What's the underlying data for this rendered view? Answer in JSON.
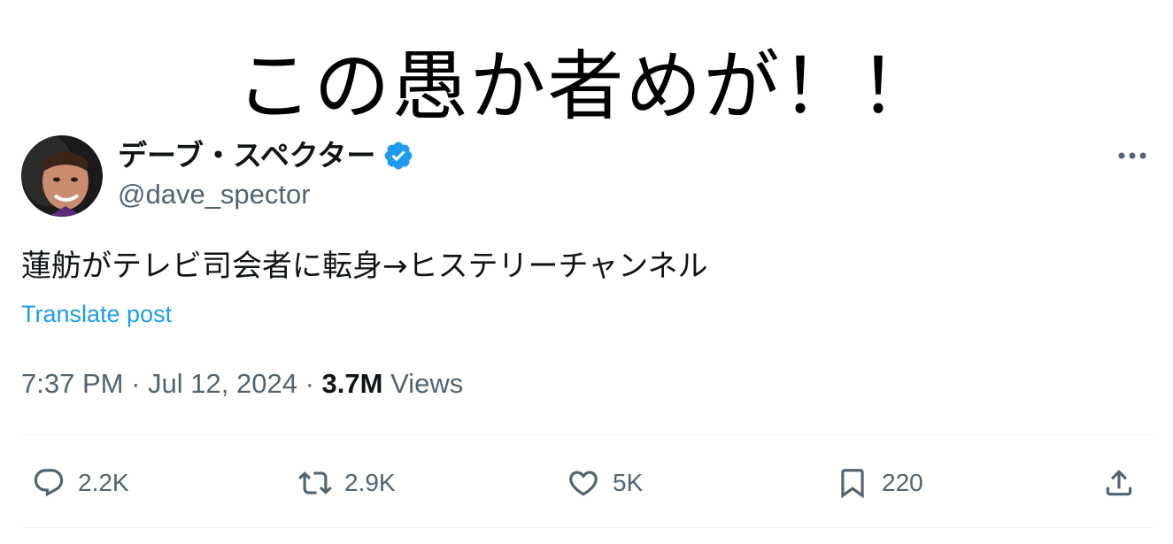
{
  "caption": "この愚か者めが！！",
  "tweet": {
    "author": {
      "display_name": "デーブ・スペクター",
      "handle": "@dave_spector",
      "verified": true
    },
    "text": "蓮舫がテレビ司会者に転身→ヒステリーチャンネル",
    "translate_label": "Translate post",
    "time": "7:37 PM",
    "date": "Jul 12, 2024",
    "separator": "·",
    "views_count": "3.7M",
    "views_label": "Views",
    "actions": {
      "reply_count": "2.2K",
      "repost_count": "2.9K",
      "like_count": "5K",
      "bookmark_count": "220"
    }
  },
  "colors": {
    "accent": "#1d9bf0",
    "secondary_text": "#536471",
    "primary_text": "#0f1419",
    "divider": "#eff3f4"
  },
  "icons": [
    "verified-badge-icon",
    "more-icon",
    "reply-icon",
    "repost-icon",
    "like-icon",
    "bookmark-icon",
    "share-icon"
  ]
}
